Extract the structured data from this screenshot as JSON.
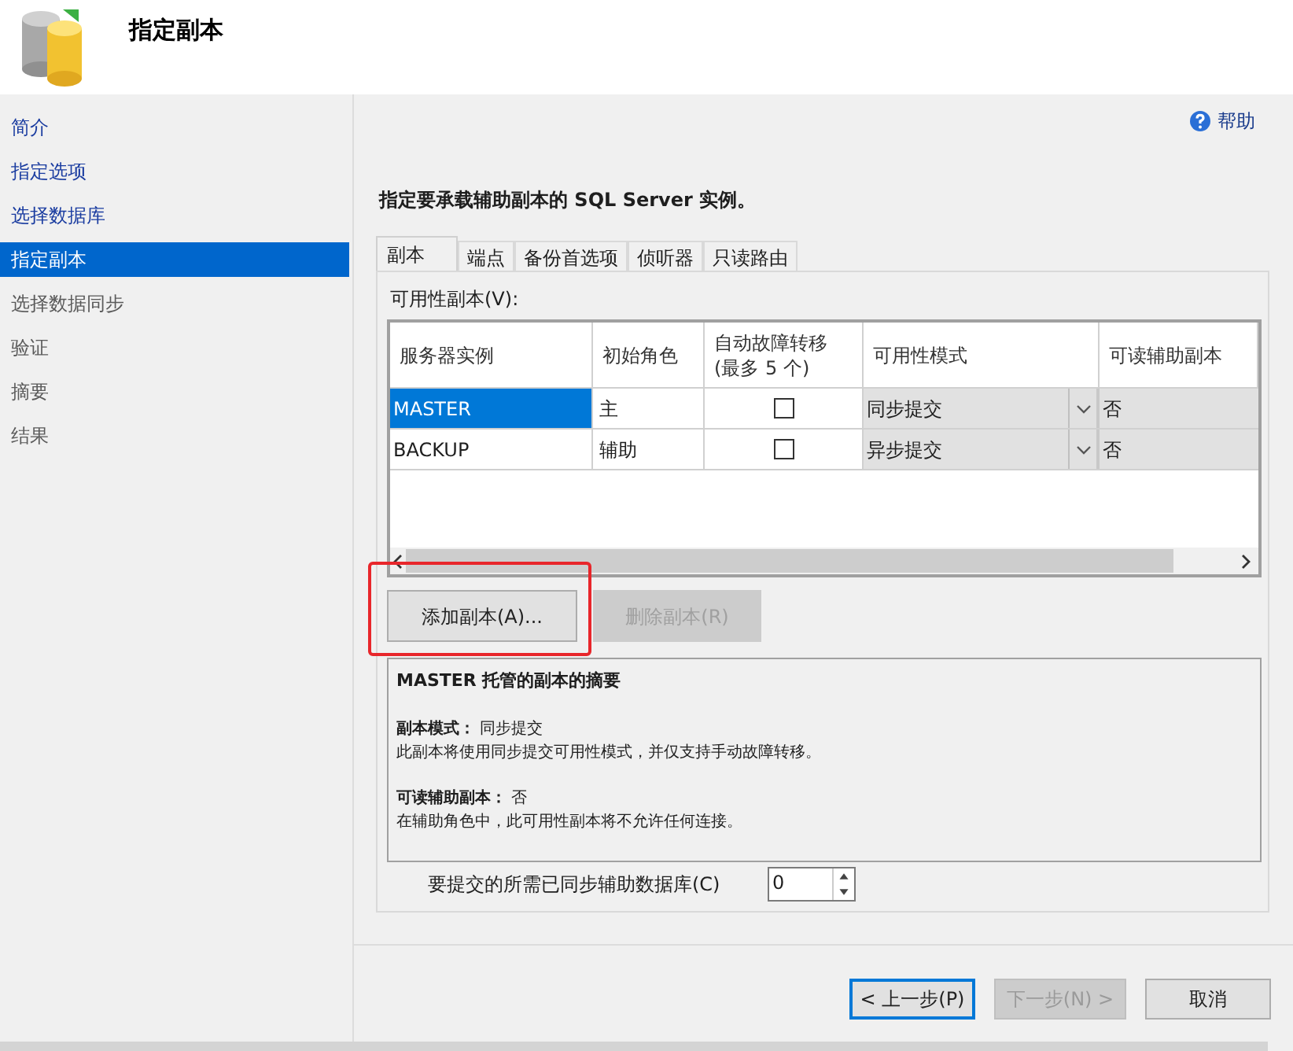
{
  "header": {
    "title": "指定副本"
  },
  "sidebar": {
    "items": [
      {
        "label": "简介",
        "selected": false,
        "completed": true
      },
      {
        "label": "指定选项",
        "selected": false,
        "completed": true
      },
      {
        "label": "选择数据库",
        "selected": false,
        "completed": true
      },
      {
        "label": "指定副本",
        "selected": true,
        "completed": false
      },
      {
        "label": "选择数据同步",
        "selected": false,
        "completed": false
      },
      {
        "label": "验证",
        "selected": false,
        "completed": false
      },
      {
        "label": "摘要",
        "selected": false,
        "completed": false
      },
      {
        "label": "结果",
        "selected": false,
        "completed": false
      }
    ]
  },
  "help": "帮助",
  "instruction": "指定要承载辅助副本的 SQL Server 实例。",
  "tabs": [
    {
      "label": "副本",
      "selected": true
    },
    {
      "label": "端点",
      "selected": false
    },
    {
      "label": "备份首选项",
      "selected": false
    },
    {
      "label": "侦听器",
      "selected": false
    },
    {
      "label": "只读路由",
      "selected": false
    }
  ],
  "replicas": {
    "label": "可用性副本(V):",
    "columns": [
      "服务器实例",
      "初始角色",
      "自动故障转移(最多 5 个)",
      "可用性模式",
      "可读辅助副本"
    ],
    "rows": [
      {
        "server": "MASTER",
        "role": "主",
        "auto_failover": false,
        "mode": "同步提交",
        "readable": "否",
        "selected": true
      },
      {
        "server": "BACKUP",
        "role": "辅助",
        "auto_failover": false,
        "mode": "异步提交",
        "readable": "否",
        "selected": false
      }
    ]
  },
  "buttons": [
    {
      "label": "添加副本(A)...",
      "disabled": false,
      "highlighted": true
    },
    {
      "label": "删除副本(R)",
      "disabled": true,
      "highlighted": false
    }
  ],
  "summary": {
    "title": "MASTER 托管的副本的摘要",
    "sections": [
      {
        "heading": "**副本模式：** 同步提交",
        "text": "此副本将使用同步提交可用性模式，并仅支持手动故障转移。"
      },
      {
        "heading": "**可读辅助副本：** 否",
        "text": "在辅助角色中，此可用性副本将不允许任何连接。"
      }
    ]
  },
  "sync_count": {
    "label": "要提交的所需已同步辅助数据库(C)",
    "value": "0"
  },
  "footer": [
    {
      "label": "< 上一步(P)",
      "disabled": false,
      "default": true
    },
    {
      "label": "下一步(N) >",
      "disabled": true,
      "default": false
    },
    {
      "label": "取消",
      "disabled": false,
      "default": false
    }
  ]
}
